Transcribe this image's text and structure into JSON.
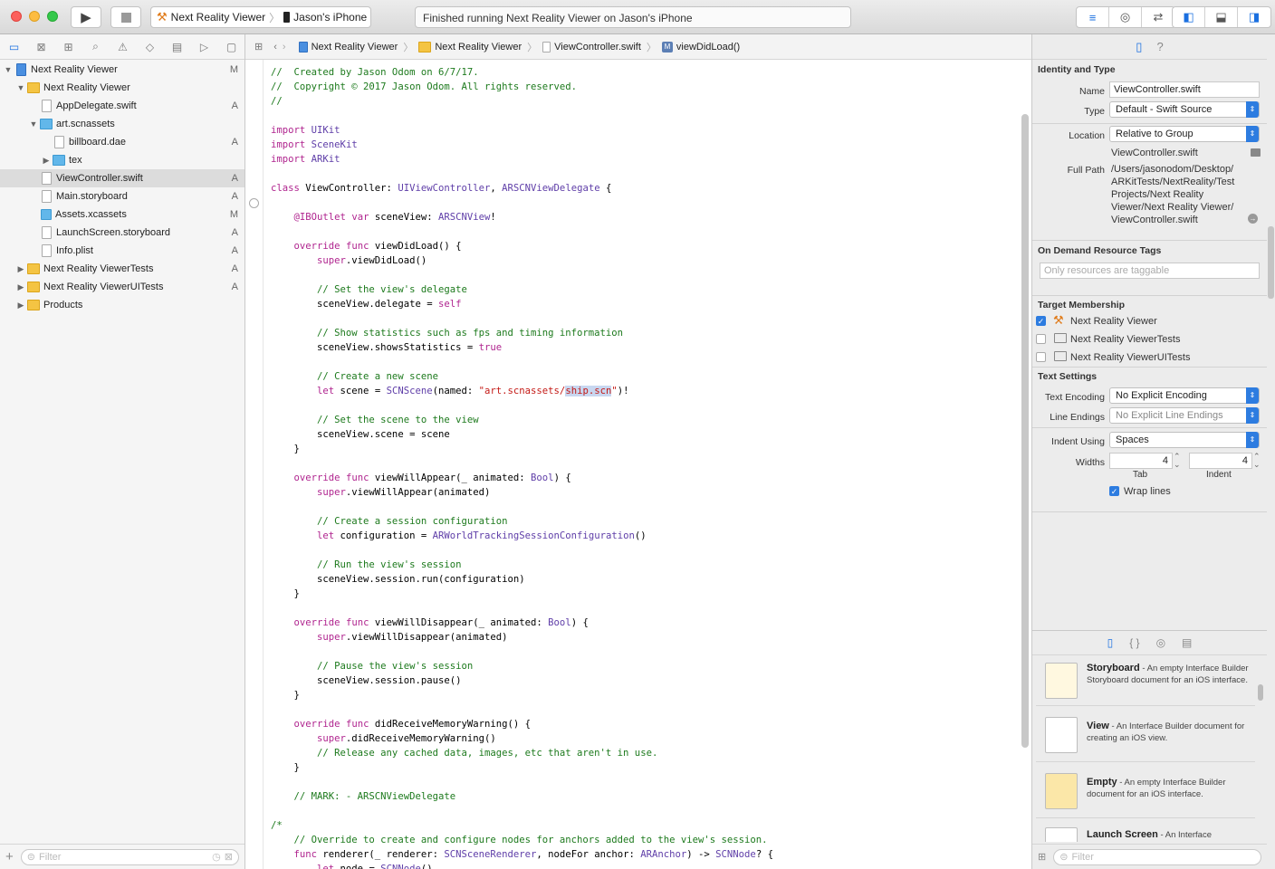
{
  "toolbar": {
    "scheme": "Next Reality Viewer",
    "device": "Jason's iPhone",
    "status": "Finished running Next Reality Viewer on Jason's iPhone"
  },
  "navigator": {
    "items": [
      {
        "label": "Next Reality Viewer",
        "badge": "M"
      },
      {
        "label": "Next Reality Viewer",
        "badge": ""
      },
      {
        "label": "AppDelegate.swift",
        "badge": "A"
      },
      {
        "label": "art.scnassets",
        "badge": ""
      },
      {
        "label": "billboard.dae",
        "badge": "A"
      },
      {
        "label": "tex",
        "badge": ""
      },
      {
        "label": "ViewController.swift",
        "badge": "A"
      },
      {
        "label": "Main.storyboard",
        "badge": "A"
      },
      {
        "label": "Assets.xcassets",
        "badge": "M"
      },
      {
        "label": "LaunchScreen.storyboard",
        "badge": "A"
      },
      {
        "label": "Info.plist",
        "badge": "A"
      },
      {
        "label": "Next Reality ViewerTests",
        "badge": "A"
      },
      {
        "label": "Next Reality ViewerUITests",
        "badge": "A"
      },
      {
        "label": "Products",
        "badge": ""
      }
    ],
    "filter_placeholder": "Filter"
  },
  "jumpbar": {
    "crumbs": [
      "Next Reality Viewer",
      "Next Reality Viewer",
      "ViewController.swift",
      "viewDidLoad()"
    ]
  },
  "inspector": {
    "identity_title": "Identity and Type",
    "name_label": "Name",
    "name_value": "ViewController.swift",
    "type_label": "Type",
    "type_value": "Default - Swift Source",
    "location_label": "Location",
    "location_value": "Relative to Group",
    "location_file": "ViewController.swift",
    "fullpath_label": "Full Path",
    "fullpath_lines": [
      "/Users/jasonodom/Desktop/",
      "ARKitTests/NextReality/Test",
      "Projects/Next Reality",
      "Viewer/Next Reality Viewer/",
      "ViewController.swift"
    ],
    "ondemand_title": "On Demand Resource Tags",
    "ondemand_placeholder": "Only resources are taggable",
    "target_title": "Target Membership",
    "targets": [
      "Next Reality Viewer",
      "Next Reality ViewerTests",
      "Next Reality ViewerUITests"
    ],
    "text_settings_title": "Text Settings",
    "encoding_label": "Text Encoding",
    "encoding_value": "No Explicit Encoding",
    "line_endings_label": "Line Endings",
    "line_endings_value": "No Explicit Line Endings",
    "indent_using_label": "Indent Using",
    "indent_using_value": "Spaces",
    "widths_label": "Widths",
    "tab_value": "4",
    "indent_value": "4",
    "tab_caption": "Tab",
    "indent_caption": "Indent",
    "wrap_lines": "Wrap lines"
  },
  "library": {
    "items": [
      {
        "title": "Storyboard",
        "desc": " - An empty Interface Builder Storyboard document for an iOS interface."
      },
      {
        "title": "View",
        "desc": " - An Interface Builder document for creating an iOS view."
      },
      {
        "title": "Empty",
        "desc": " - An empty Interface Builder document for an iOS interface."
      },
      {
        "title": "Launch Screen",
        "desc": " - An Interface"
      }
    ],
    "filter_placeholder": "Filter"
  },
  "code_lines": [
    "//  Created by Jason Odom on 6/7/17.",
    "//  Copyright © 2017 Jason Odom. All rights reserved.",
    "//",
    "",
    "import UIKit",
    "import SceneKit",
    "import ARKit",
    "",
    "class ViewController: UIViewController, ARSCNViewDelegate {",
    "",
    "    @IBOutlet var sceneView: ARSCNView!",
    "",
    "    override func viewDidLoad() {",
    "        super.viewDidLoad()",
    "",
    "        // Set the view's delegate",
    "        sceneView.delegate = self",
    "",
    "        // Show statistics such as fps and timing information",
    "        sceneView.showsStatistics = true",
    "",
    "        // Create a new scene",
    "        let scene = SCNScene(named: \"art.scnassets/ship.scn\")!",
    "",
    "        // Set the scene to the view",
    "        sceneView.scene = scene",
    "    }",
    "",
    "    override func viewWillAppear(_ animated: Bool) {",
    "        super.viewWillAppear(animated)",
    "",
    "        // Create a session configuration",
    "        let configuration = ARWorldTrackingSessionConfiguration()",
    "",
    "        // Run the view's session",
    "        sceneView.session.run(configuration)",
    "    }",
    "",
    "    override func viewWillDisappear(_ animated: Bool) {",
    "        super.viewWillDisappear(animated)",
    "",
    "        // Pause the view's session",
    "        sceneView.session.pause()",
    "    }",
    "",
    "    override func didReceiveMemoryWarning() {",
    "        super.didReceiveMemoryWarning()",
    "        // Release any cached data, images, etc that aren't in use.",
    "    }",
    "",
    "    // MARK: - ARSCNViewDelegate",
    "",
    "/*",
    "    // Override to create and configure nodes for anchors added to the view's session.",
    "    func renderer(_ renderer: SCNSceneRenderer, nodeFor anchor: ARAnchor) -> SCNNode? {",
    "        let node = SCNNode()"
  ]
}
